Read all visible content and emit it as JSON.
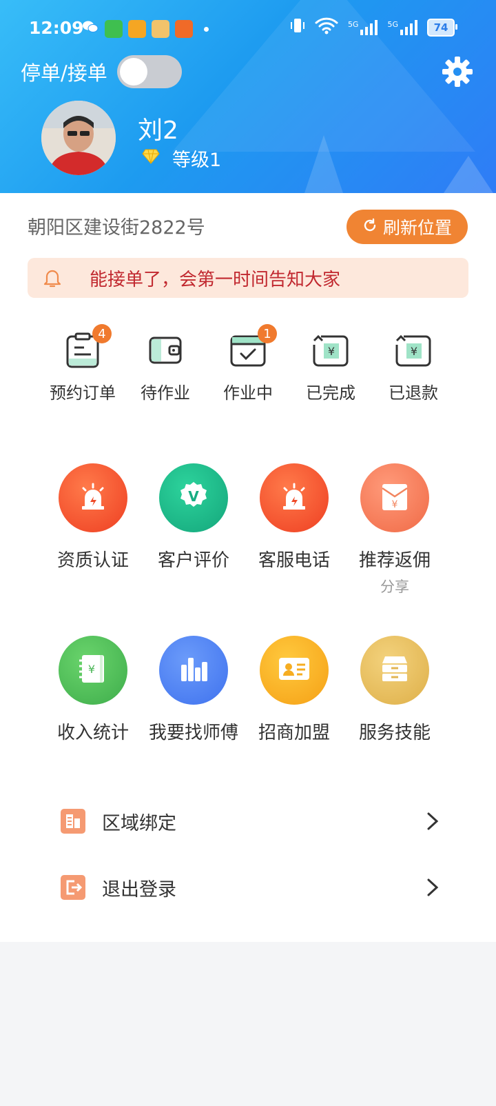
{
  "status_bar": {
    "time": "12:09",
    "signal1": "5G",
    "signal2": "5G",
    "battery": "74"
  },
  "header": {
    "toggle_label": "停单/接单",
    "toggle_on": false,
    "username": "刘2",
    "level": "等级1"
  },
  "location": {
    "address": "朝阳区建设街2822号",
    "refresh_label": "刷新位置"
  },
  "notice": {
    "text": "能接单了，会第一时间告知大家"
  },
  "orders": [
    {
      "label": "预约订单",
      "badge": "4",
      "icon": "clipboard-icon"
    },
    {
      "label": "待作业",
      "badge": "",
      "icon": "wallet-icon"
    },
    {
      "label": "作业中",
      "badge": "1",
      "icon": "calendar-check-icon"
    },
    {
      "label": "已完成",
      "badge": "",
      "icon": "yuan-return-icon"
    },
    {
      "label": "已退款",
      "badge": "",
      "icon": "yuan-refund-icon"
    }
  ],
  "services_row1": [
    {
      "label": "资质认证",
      "sub": "",
      "icon": "alarm-light-icon",
      "color": "#f2542f"
    },
    {
      "label": "客户评价",
      "sub": "",
      "icon": "verified-badge-icon",
      "color": "#1cb88a"
    },
    {
      "label": "客服电话",
      "sub": "",
      "icon": "alarm-light-icon",
      "color": "#f2542f"
    },
    {
      "label": "推荐返佣",
      "sub": "分享",
      "icon": "red-envelope-icon",
      "color": "#f47a5c"
    }
  ],
  "services_row2": [
    {
      "label": "收入统计",
      "sub": "",
      "icon": "ledger-icon",
      "color": "#52c05a"
    },
    {
      "label": "我要找师傅",
      "sub": "",
      "icon": "bar-chart-icon",
      "color": "#4f86f6"
    },
    {
      "label": "招商加盟",
      "sub": "",
      "icon": "id-card-icon",
      "color": "#f6b21e"
    },
    {
      "label": "服务技能",
      "sub": "",
      "icon": "cabinet-icon",
      "color": "#e6bd5f"
    }
  ],
  "menu": [
    {
      "label": "区域绑定",
      "icon": "region-bind-icon"
    },
    {
      "label": "退出登录",
      "icon": "logout-icon"
    }
  ]
}
